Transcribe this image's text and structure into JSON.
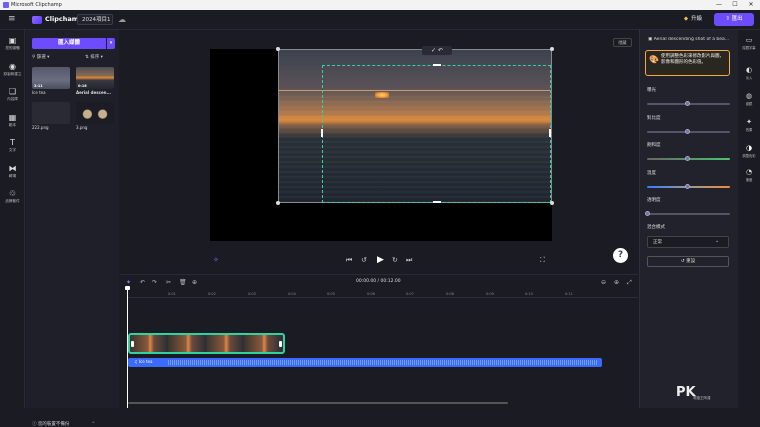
{
  "window": {
    "title": "Microsoft Clipchamp",
    "controls": [
      "—",
      "☐",
      "✕"
    ]
  },
  "appbar": {
    "brand": "Clipchamp",
    "project_name": "2024項目1",
    "upgrade_label": "升級",
    "export_label": "匯出"
  },
  "left_rail": [
    {
      "icon": "folder-icon",
      "glyph": "▣",
      "label": "您的媒體"
    },
    {
      "icon": "record-icon",
      "glyph": "◉",
      "label": "錄製和建立"
    },
    {
      "icon": "content-library-icon",
      "glyph": "❏",
      "label": "內容庫"
    },
    {
      "icon": "templates-icon",
      "glyph": "▦",
      "label": "範本"
    },
    {
      "icon": "text-icon",
      "glyph": "T",
      "label": "文字"
    },
    {
      "icon": "transitions-icon",
      "glyph": "⧓",
      "label": "轉場"
    },
    {
      "icon": "brand-kit-icon",
      "glyph": "♲",
      "label": "品牌套件"
    }
  ],
  "media": {
    "import_label": "匯入媒體",
    "filter_label": "篩選",
    "sort_label": "排序",
    "items": [
      {
        "name": "Ice tea",
        "duration": "2:11",
        "kind": "video"
      },
      {
        "name": "Aerial descen...",
        "duration": "0:16",
        "kind": "sunset"
      },
      {
        "name": "222.png",
        "duration": "",
        "kind": "image"
      },
      {
        "name": "3.png",
        "duration": "",
        "kind": "image"
      }
    ],
    "notification": "您的裝置不備份"
  },
  "preview": {
    "hide_label": "隱藏",
    "confirm_icon": "✓",
    "undo_icon": "↶"
  },
  "timeline": {
    "timecode": "00:00.00 / 00:12.00",
    "ticks": [
      "0:01",
      "0:02",
      "0:03",
      "0:04",
      "0:05",
      "0:06",
      "0:07",
      "0:08",
      "0:09",
      "0:10",
      "0:11"
    ],
    "audio_label": "Ice tea"
  },
  "color_panel": {
    "title": "Aerial descending shot of a bea...",
    "info": "使用調整色彩來修改影片與圖，影像和圖形的色彩值。",
    "sliders": [
      {
        "label": "曝光",
        "value": 0.5,
        "color": "#6b6b7b"
      },
      {
        "label": "對比度",
        "value": 0.5,
        "color": "#6b6b7b"
      },
      {
        "label": "飽和度",
        "value": 0.5,
        "color": "gradient-green"
      },
      {
        "label": "溫度",
        "value": 0.5,
        "color": "gradient-temp"
      },
      {
        "label": "透明度",
        "value": 0.0,
        "color": "#6b6b7b"
      }
    ],
    "blend_label": "混合模式",
    "blend_value": "正常",
    "reset_label": "重設"
  },
  "right_rail": [
    {
      "icon": "captions-icon",
      "glyph": "▭",
      "label": "隱藏字幕"
    },
    {
      "icon": "fade-icon",
      "glyph": "◐",
      "label": "淡入"
    },
    {
      "icon": "filters-icon",
      "glyph": "◍",
      "label": "濾鏡"
    },
    {
      "icon": "effects-icon",
      "glyph": "✦",
      "label": "效果"
    },
    {
      "icon": "adjust-colors-icon",
      "glyph": "◑",
      "label": "調整色彩"
    },
    {
      "icon": "speed-icon",
      "glyph": "◔",
      "label": "速度"
    }
  ],
  "watermark": {
    "text": "PK",
    "sub": "電腦王阿達"
  }
}
